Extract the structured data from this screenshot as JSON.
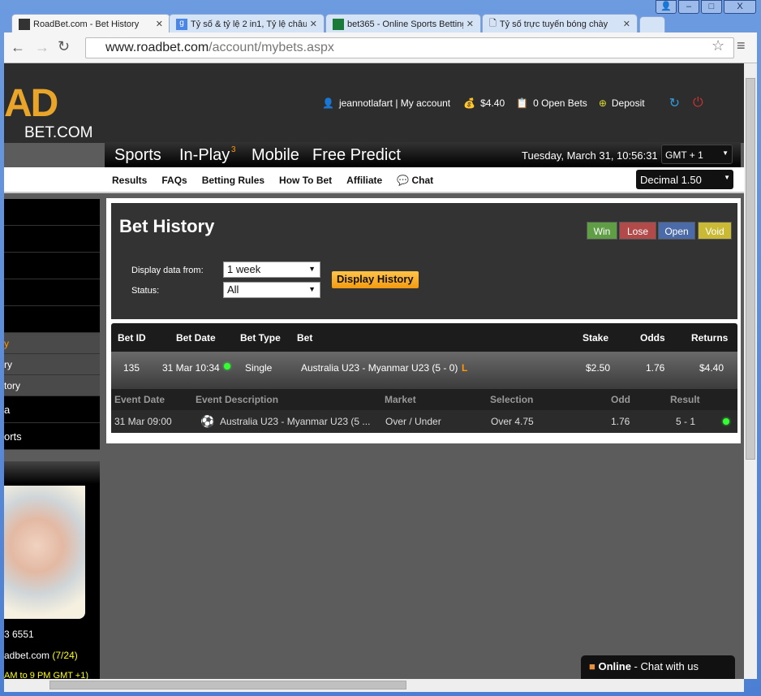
{
  "browser": {
    "tabs": [
      {
        "title": "RoadBet.com - Bet History",
        "active": true
      },
      {
        "title": "Tỷ số & tỷ lệ 2 in1, Tỷ lệ châu"
      },
      {
        "title": "bet365 - Online Sports Betting"
      },
      {
        "title": "Tỷ số trực tuyến bóng chày"
      }
    ],
    "url_host": "www.roadbet.com",
    "url_path": "/account/mybets.aspx"
  },
  "header": {
    "logo_big": "AD",
    "logo_small": "BET.COM",
    "user": "jeannotlafart | My account",
    "balance": "$4.40",
    "open_bets": "0 Open Bets",
    "deposit": "Deposit"
  },
  "nav": {
    "items": [
      "Sports",
      "In-Play",
      "Mobile",
      "Free Predict"
    ],
    "inplay_count": "3",
    "datetime": "Tuesday, March 31,  10:56:31",
    "timezone": "GMT + 1"
  },
  "subnav": {
    "items": [
      "Results",
      "FAQs",
      "Betting Rules",
      "How To Bet",
      "Affiliate",
      "Chat"
    ],
    "odds_format": "Decimal 1.50"
  },
  "sidebar": {
    "items": [
      "",
      "",
      "",
      "",
      "",
      "y",
      "ry",
      "tory",
      "a",
      "orts"
    ],
    "phone": "3 6551",
    "email": "adbet.com",
    "email_note": "(7/24)",
    "hours": "AM to 9 PM GMT +1)"
  },
  "bet_history": {
    "title": "Bet History",
    "legend": [
      {
        "label": "Win",
        "color": "#5f9e45"
      },
      {
        "label": "Lose",
        "color": "#b34a4a"
      },
      {
        "label": "Open",
        "color": "#4a6aa8"
      },
      {
        "label": "Void",
        "color": "#c9b934"
      }
    ],
    "display_from_label": "Display data from:",
    "display_from_value": "1 week",
    "status_label": "Status:",
    "status_value": "All",
    "button": "Display History",
    "columns": [
      "Bet ID",
      "Bet Date",
      "Bet Type",
      "Bet",
      "Stake",
      "Odds",
      "Returns"
    ],
    "row": {
      "id": "135",
      "date": "31 Mar 10:34",
      "type": "Single",
      "bet": "Australia U23 - Myanmar U23 (5 - 0)",
      "flag": "L",
      "stake": "$2.50",
      "odds": "1.76",
      "returns": "$4.40"
    },
    "detail_columns": [
      "Event Date",
      "Event Description",
      "Market",
      "Selection",
      "Odd",
      "Result"
    ],
    "detail": {
      "date": "31 Mar 09:00",
      "description": "Australia U23 - Myanmar U23 (5 ...",
      "market": "Over / Under",
      "selection": "Over 4.75",
      "odd": "1.76",
      "result": "5 - 1"
    }
  },
  "chat_widget": {
    "status": "Online",
    "text": " - Chat with us"
  }
}
